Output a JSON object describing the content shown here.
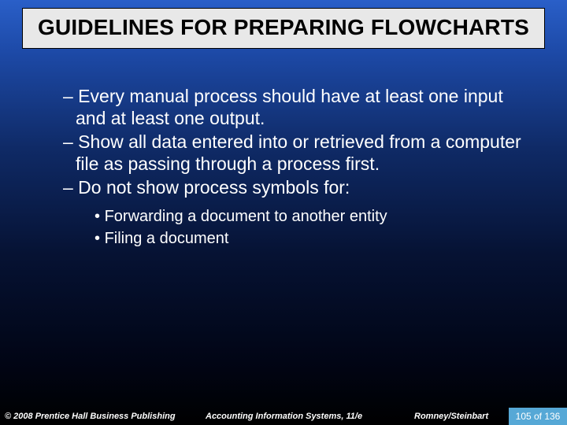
{
  "title": "GUIDELINES FOR PREPARING FLOWCHARTS",
  "bullets": {
    "dash1": "– Every manual process should have at least one input and at least one output.",
    "dash2": "– Show all data entered into or retrieved from a computer file as passing through a process first.",
    "dash3": "– Do not show process symbols for:",
    "sub1": "Forwarding a document to another entity",
    "sub2": "Filing a document"
  },
  "footer": {
    "copyright": "© 2008 Prentice Hall Business Publishing",
    "center": "Accounting Information Systems, 11/e",
    "authors": "Romney/Steinbart",
    "page": "105 of 136"
  }
}
